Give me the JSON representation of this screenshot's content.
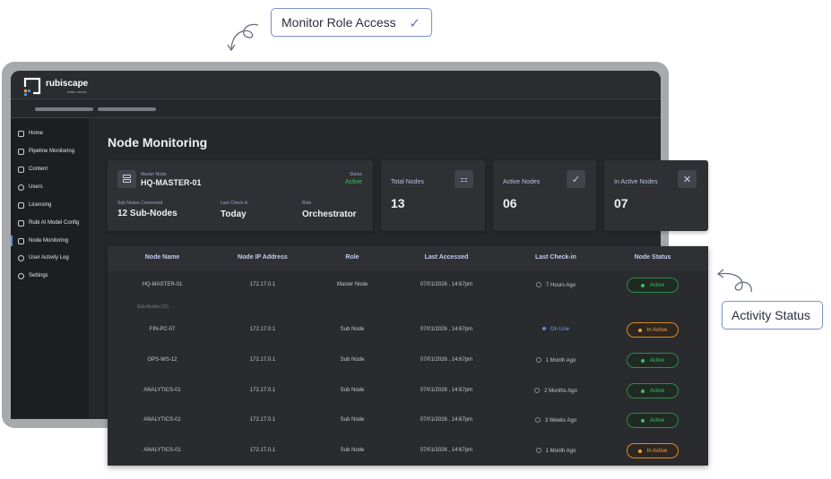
{
  "callouts": {
    "top": "Monitor Role Access",
    "right": "Activity Status"
  },
  "brand": {
    "name": "rubiscape",
    "tagline": "make sense"
  },
  "sidebar": {
    "items": [
      {
        "label": "Home",
        "icon": "home-icon"
      },
      {
        "label": "Pipeline Monitoring",
        "icon": "pipeline-icon"
      },
      {
        "label": "Content",
        "icon": "content-icon"
      },
      {
        "label": "Users",
        "icon": "users-icon"
      },
      {
        "label": "Licensing",
        "icon": "license-icon"
      },
      {
        "label": "Rubi AI Model Config",
        "icon": "model-config-icon"
      },
      {
        "label": "Node Monitoring",
        "icon": "node-icon",
        "active": true
      },
      {
        "label": "User Activity Log",
        "icon": "activity-log-icon"
      },
      {
        "label": "Settings",
        "icon": "gear-icon"
      }
    ]
  },
  "page": {
    "title": "Node Monitoring"
  },
  "master": {
    "label": "Master Node",
    "name": "HQ-MASTER-01",
    "status_label": "Status",
    "status": "Active",
    "sub_label": "Sub Nodes Connected",
    "sub_value": "12 Sub-Nodes",
    "checkin_label": "Last Check-in",
    "checkin_value": "Today",
    "role_label": "Role",
    "role_value": "Orchestrator"
  },
  "stats": [
    {
      "title": "Total Nodes",
      "value": "13",
      "icon": "nodes-grid-icon"
    },
    {
      "title": "Active Nodes",
      "value": "06",
      "icon": "check-icon"
    },
    {
      "title": "In Active Nodes",
      "value": "07",
      "icon": "close-icon"
    }
  ],
  "table": {
    "columns": [
      "Node Name",
      "Node IP Address",
      "Role",
      "Last Accessed",
      "Last Check-in",
      "Node Status"
    ],
    "sub_nodes_label": "Sub-Nodes (11)",
    "rows": [
      {
        "name": "HQ-MASTER-01",
        "ip": "172.17.0.1",
        "role": "Master Node",
        "accessed": "07/01/2026 , 14:67pm",
        "checkin": "7 Hours Ago",
        "status": "Active"
      },
      {
        "name": "FIN-PC-07",
        "ip": "172.17.0.1",
        "role": "Sub Node",
        "accessed": "07/01/2026 , 14:67pm",
        "checkin": "On Line",
        "status": "In Active"
      },
      {
        "name": "OPS-WS-12",
        "ip": "172.17.0.1",
        "role": "Sub Node",
        "accessed": "07/01/2026 , 14:67pm",
        "checkin": "1 Month Ago",
        "status": "Active"
      },
      {
        "name": "ANALYTICS-01",
        "ip": "172.17.0.1",
        "role": "Sub Node",
        "accessed": "07/01/2026 , 14:67pm",
        "checkin": "2 Months Ago",
        "status": "Active"
      },
      {
        "name": "ANALYTICS-01",
        "ip": "172.17.0.1",
        "role": "Sub Node",
        "accessed": "07/01/2026 , 14:67pm",
        "checkin": "3 Weeks Ago",
        "status": "Active"
      },
      {
        "name": "ANALYTICS-01",
        "ip": "172.17.0.1",
        "role": "Sub Node",
        "accessed": "07/01/2026 , 14:67pm",
        "checkin": "1 Month Ago",
        "status": "In Active"
      }
    ]
  },
  "colors": {
    "accent": "#4f8fe8",
    "active": "#3fbf66",
    "inactive": "#f0a040",
    "callout_border": "#7b95c9"
  }
}
